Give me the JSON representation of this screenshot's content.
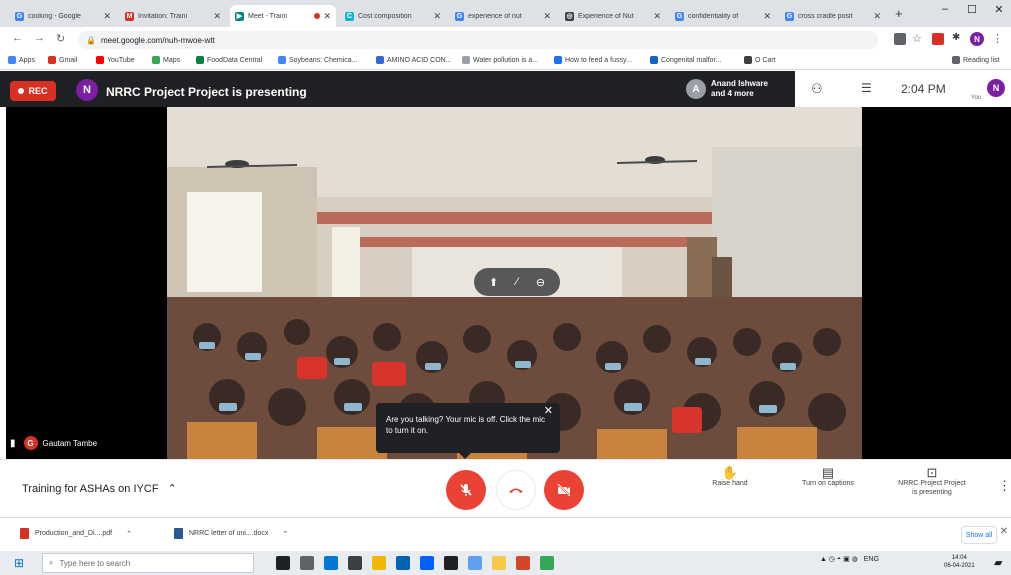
{
  "browser": {
    "tabs": [
      {
        "title": "cooking - Google",
        "fav_color": "#4285f4",
        "fav_glyph": "G"
      },
      {
        "title": "Invitation: Traini",
        "fav_color": "#d93025",
        "fav_glyph": "M"
      },
      {
        "title": "Meet - Traini",
        "fav_color": "#00897b",
        "fav_glyph": "▶",
        "active": true,
        "recording": true
      },
      {
        "title": "Cost composition",
        "fav_color": "#12b5cb",
        "fav_glyph": "C"
      },
      {
        "title": "experience of nut",
        "fav_color": "#4285f4",
        "fav_glyph": "G"
      },
      {
        "title": "Experience of Nut",
        "fav_color": "#3c4043",
        "fav_glyph": "◎"
      },
      {
        "title": "confidentiality of",
        "fav_color": "#4285f4",
        "fav_glyph": "G"
      },
      {
        "title": "cross cradle posit",
        "fav_color": "#4285f4",
        "fav_glyph": "G"
      }
    ],
    "new_tab_label": "+",
    "window_controls": [
      "–",
      "☐",
      "✕"
    ],
    "url": "meet.google.com/nuh-mwoe-wtt",
    "bookmarks": [
      {
        "label": "Apps",
        "color": "#4285f4"
      },
      {
        "label": "Gmail",
        "color": "#d93025"
      },
      {
        "label": "YouTube",
        "color": "#ff0000"
      },
      {
        "label": "Maps",
        "color": "#34a853"
      },
      {
        "label": "FoodData Central",
        "color": "#0b8043"
      },
      {
        "label": "Soybeans: Chemica...",
        "color": "#4285f4"
      },
      {
        "label": "AMINO ACID CON...",
        "color": "#3367d6"
      },
      {
        "label": "Water pollution is a...",
        "color": "#9aa0a6"
      },
      {
        "label": "How to feed a fussy...",
        "color": "#1a73e8"
      },
      {
        "label": "Congenital malfor...",
        "color": "#1565c0"
      },
      {
        "label": "O Cart",
        "color": "#3c4043"
      }
    ],
    "reading_list_label": "Reading list"
  },
  "meet": {
    "rec_label": "REC",
    "presenter_avatar_letter": "N",
    "presenter_avatar_color": "#7b1fa2",
    "presenting_title": "NRRC Project Project is presenting",
    "participants_line1": "Anand Ishware",
    "participants_line2": "and 4 more",
    "participant_avatar_letter": "A",
    "time": "2:04 PM",
    "you_label": "You",
    "self_avatar_letter": "N",
    "tooltip_text": "Are you talking? Your mic is off. Click the mic to turn it on.",
    "tooltip_close": "✕",
    "speaker_name": "Gautam Tambe",
    "speaker_avatar_letter": "G",
    "meeting_title": "Training for ASHAs on IYCF",
    "raise_hand_label": "Raise hand",
    "captions_label": "Turn on captions",
    "presenting_btn_line1": "NRRC Project Project",
    "presenting_btn_line2": "is presenting",
    "accent_red": "#ea4335"
  },
  "downloads": {
    "items": [
      {
        "name": "Production_and_Di....pdf",
        "color": "#d93025"
      },
      {
        "name": "NRRC letter of uni....docx",
        "color": "#2b579a"
      }
    ],
    "show_all_label": "Show all"
  },
  "taskbar": {
    "search_placeholder": "Type here to search",
    "apps": [
      {
        "name": "cortana-icon",
        "color": "#202124"
      },
      {
        "name": "task-view-icon",
        "color": "#5f6368"
      },
      {
        "name": "edge-icon",
        "color": "#0078d4"
      },
      {
        "name": "store-icon",
        "color": "#3c4043"
      },
      {
        "name": "file-explorer-icon",
        "color": "#f2b705"
      },
      {
        "name": "mail-icon",
        "color": "#0063b1"
      },
      {
        "name": "dropbox-icon",
        "color": "#0061fe"
      },
      {
        "name": "app-icon",
        "color": "#202124"
      },
      {
        "name": "photos-icon",
        "color": "#5ea0ef"
      },
      {
        "name": "sticky-notes-icon",
        "color": "#f7c948"
      },
      {
        "name": "powerpoint-icon",
        "color": "#d24726"
      },
      {
        "name": "chrome-icon",
        "color": "#34a853"
      }
    ],
    "lang": "ENG",
    "time": "14:04",
    "date": "06-04-2021"
  }
}
